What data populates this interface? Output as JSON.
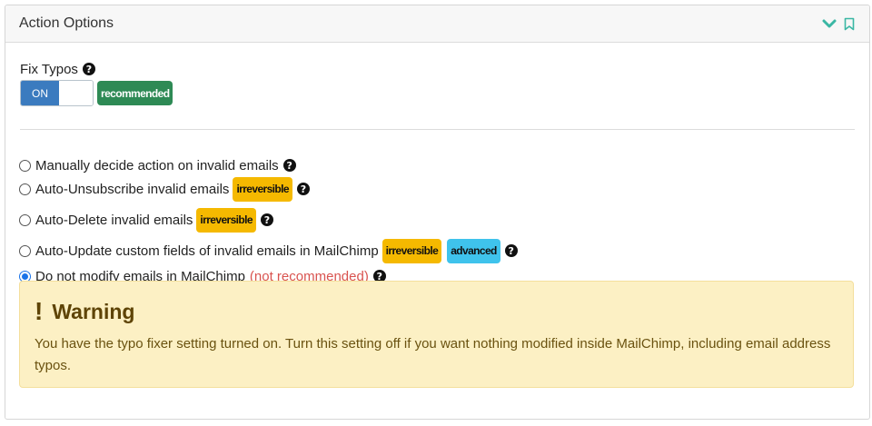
{
  "panel": {
    "title": "Action Options",
    "icons": [
      "chevron-down-icon",
      "bookmark-icon"
    ]
  },
  "fix_typos": {
    "label": "Fix Typos",
    "toggle_label": "ON",
    "toggle_state": "on",
    "badge": "recommended"
  },
  "options": [
    {
      "label": "Manually decide action on invalid emails",
      "checked": false
    },
    {
      "label": "Auto-Unsubscribe invalid emails",
      "badge": "irreversible",
      "checked": false
    },
    {
      "label": "Auto-Delete invalid emails",
      "badge": "irreversible",
      "checked": false
    },
    {
      "label": "Auto-Update custom fields of invalid emails in MailChimp",
      "badge": "irreversible",
      "badge2": "advanced",
      "checked": false
    },
    {
      "label": "Do not modify emails in MailChimp",
      "note": "(not recommended)",
      "checked": true
    }
  ],
  "warning": {
    "title": "Warning",
    "text": "You have the typo fixer setting turned on. Turn this setting off if you want nothing modified inside MailChimp, including email address typos."
  },
  "colors": {
    "accent": "#3b7bbf",
    "recommended": "#2e8a55",
    "irreversible": "#f5b900",
    "advanced": "#3fc3ec",
    "warning_bg": "#fcf0c4",
    "not_recommended": "#d9534f",
    "teal_icon": "#3ab7a4"
  }
}
